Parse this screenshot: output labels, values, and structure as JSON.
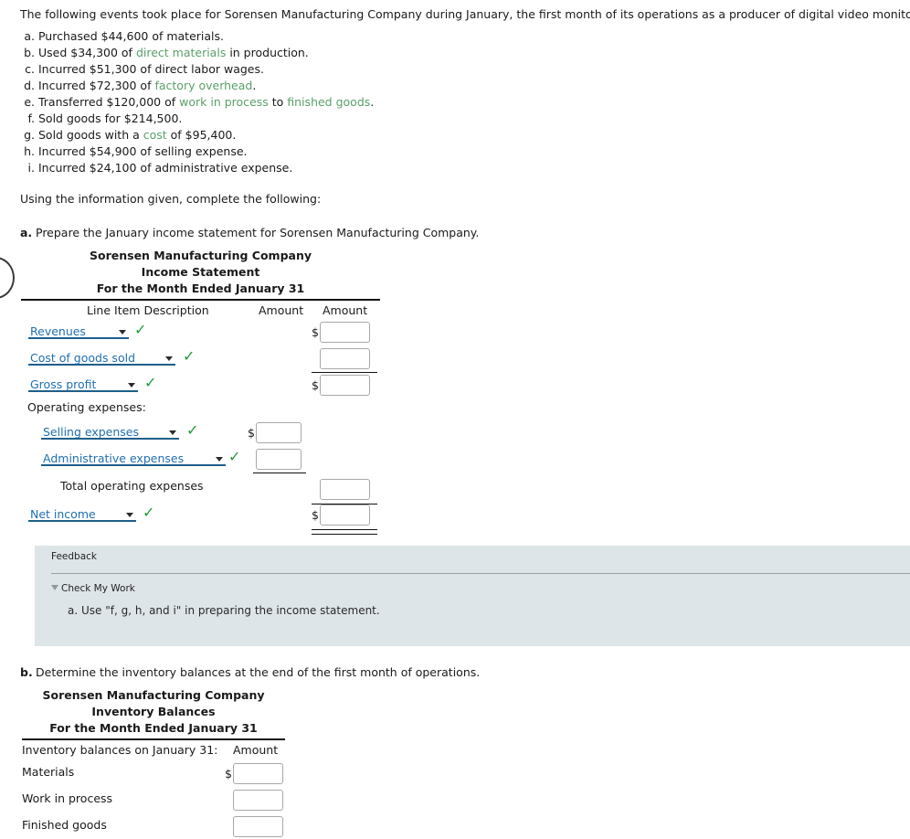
{
  "intro": "The following events took place for Sorensen Manufacturing Company during January, the first month of its operations as a producer of digital video monitors:",
  "events": [
    {
      "letter": "a.",
      "pre": "Purchased $44,600 of materials.",
      "link": "",
      "post": ""
    },
    {
      "letter": "b.",
      "pre": "Used $34,300 of ",
      "link": "direct materials",
      "post": " in production."
    },
    {
      "letter": "c.",
      "pre": "Incurred $51,300 of direct labor wages.",
      "link": "",
      "post": ""
    },
    {
      "letter": "d.",
      "pre": "Incurred $72,300 of ",
      "link": "factory overhead",
      "post": "."
    },
    {
      "letter": "e.",
      "pre": "Transferred $120,000 of ",
      "link": "work in process",
      "mid": " to ",
      "link2": "finished goods",
      "post": "."
    },
    {
      "letter": "f.",
      "pre": "Sold goods for $214,500.",
      "link": "",
      "post": ""
    },
    {
      "letter": "g.",
      "pre": "Sold goods with a ",
      "link": "cost",
      "post": " of $95,400."
    },
    {
      "letter": "h.",
      "pre": "Incurred $54,900 of selling expense.",
      "link": "",
      "post": ""
    },
    {
      "letter": "i.",
      "pre": "Incurred $24,100 of administrative expense.",
      "link": "",
      "post": ""
    }
  ],
  "using_line": "Using the information given, complete the following:",
  "part_a": {
    "letter": "a.",
    "prompt": "Prepare the January income statement for Sorensen Manufacturing Company.",
    "title_1": "Sorensen Manufacturing Company",
    "title_2": "Income Statement",
    "title_3": "For the Month Ended January 31",
    "col_desc": "Line Item Description",
    "col_amount_1": "Amount",
    "col_amount_2": "Amount",
    "rows": {
      "revenues": "Revenues",
      "cogs": "Cost of goods sold",
      "gross_profit": "Gross profit",
      "operating_expenses_label": "Operating expenses:",
      "selling": "Selling expenses",
      "administrative": "Administrative expenses",
      "total_operating": "Total operating expenses",
      "net_income": "Net income"
    },
    "values": {
      "revenues": "",
      "cogs": "",
      "gross_profit": "",
      "selling": "",
      "administrative": "",
      "total_operating": "",
      "net_income": ""
    },
    "dollar_sign": "$",
    "check_glyph": "✓"
  },
  "feedback": {
    "title": "Feedback",
    "check_my_work": "Check My Work",
    "body": "a. Use \"f, g, h, and i\" in preparing the income statement."
  },
  "part_b": {
    "letter": "b.",
    "prompt": "Determine the inventory balances at the end of the first month of operations.",
    "title_1": "Sorensen Manufacturing Company",
    "title_2": "Inventory Balances",
    "title_3": "For the Month Ended January 31",
    "col_desc": "Inventory balances on January 31:",
    "col_amount": "Amount",
    "rows": {
      "materials": "Materials",
      "wip": "Work in process",
      "finished_goods": "Finished goods"
    },
    "values": {
      "materials": "",
      "wip": "",
      "finished_goods": ""
    },
    "dollar_sign": "$"
  },
  "colors": {
    "link_green": "#5aa06a",
    "dropdown_blue": "#1f6fb2",
    "check_green": "#219a3a",
    "feedback_bg": "#dee5e8"
  }
}
